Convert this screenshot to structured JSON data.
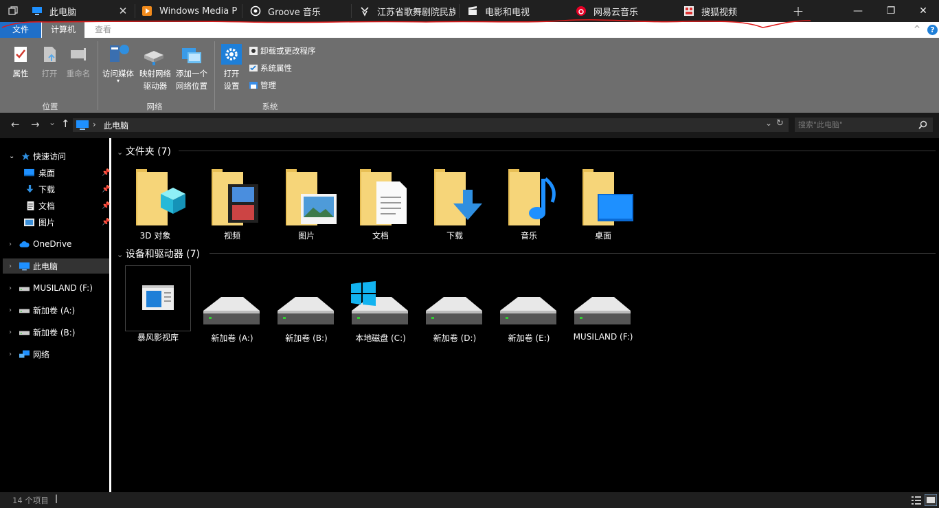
{
  "tabs": [
    {
      "label": "此电脑",
      "icon": "computer-icon"
    },
    {
      "label": "Windows Media Pla",
      "icon": "media-player-icon"
    },
    {
      "label": "Groove 音乐",
      "icon": "groove-icon"
    },
    {
      "label": "江苏省歌舞剧院民族",
      "icon": "app-icon"
    },
    {
      "label": "电影和电视",
      "icon": "clapper-icon"
    },
    {
      "label": "网易云音乐",
      "icon": "netease-icon"
    },
    {
      "label": "搜狐视频",
      "icon": "sohu-icon"
    }
  ],
  "tab_close_glyph": "✕",
  "new_tab_glyph": "+",
  "window": {
    "minimize": "—",
    "maximize": "❐",
    "close": "✕"
  },
  "ribbon_tabs": [
    "文件",
    "计算机",
    "查看"
  ],
  "ribbon": {
    "location": {
      "properties": "属性",
      "open": "打开",
      "rename": "重命名",
      "group": "位置"
    },
    "network": {
      "access_media_1": "访问媒体",
      "map_drive_1": "映射网络",
      "map_drive_2": "驱动器",
      "add_location_1": "添加一个",
      "add_location_2": "网络位置",
      "group": "网络"
    },
    "system": {
      "open_settings_1": "打开",
      "open_settings_2": "设置",
      "uninstall": "卸载或更改程序",
      "system_props": "系统属性",
      "manage": "管理",
      "group": "系统"
    }
  },
  "address": {
    "back": "←",
    "forward": "→",
    "recent": "⌄",
    "up": "↑",
    "crumb_sep": "›",
    "path": "此电脑",
    "search_placeholder": "搜索\"此电脑\""
  },
  "nav": {
    "quick_access": "快速访问",
    "quick_items": [
      "桌面",
      "下载",
      "文档",
      "图片"
    ],
    "onedrive": "OneDrive",
    "this_pc": "此电脑",
    "musiland": "MUSILAND (F:)",
    "vol_a": "新加卷 (A:)",
    "vol_b": "新加卷 (B:)",
    "network": "网络"
  },
  "folders_section": "文件夹 (7)",
  "folders": [
    "3D 对象",
    "视频",
    "图片",
    "文档",
    "下载",
    "音乐",
    "桌面"
  ],
  "drives_section": "设备和驱动器 (7)",
  "drives": [
    "暴风影视库",
    "新加卷 (A:)",
    "新加卷 (B:)",
    "本地磁盘 (C:)",
    "新加卷 (D:)",
    "新加卷 (E:)",
    "MUSILAND (F:)"
  ],
  "status": {
    "count": "14 个项目"
  },
  "colors": {
    "accent": "#1e90ff",
    "annotation": "#e01b1b",
    "folder": "#f6d579"
  }
}
